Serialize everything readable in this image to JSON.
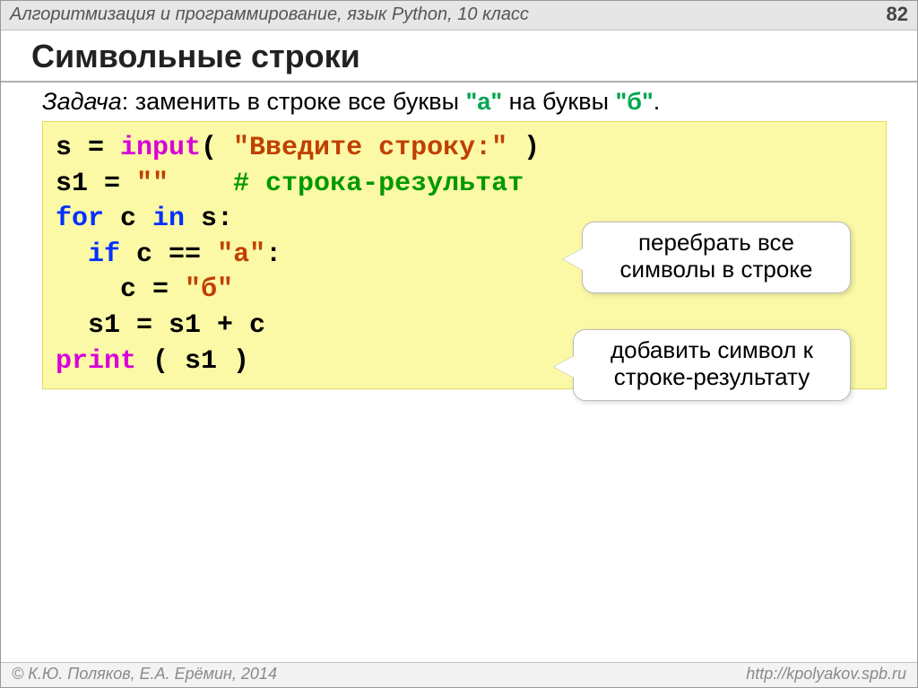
{
  "header": {
    "subject": "Алгоритмизация и программирование, язык Python, 10 класс",
    "page": "82"
  },
  "title": "Символьные строки",
  "task": {
    "label": "Задача",
    "before": ": заменить в строке все буквы ",
    "a": "\"а\"",
    "mid": " на буквы ",
    "b": "\"б\"",
    "end": "."
  },
  "code": {
    "l1_a": "s = ",
    "l1_fn": "input",
    "l1_b": "( ",
    "l1_str": "\"Введите строку:\"",
    "l1_c": " )",
    "l2_a": "s1 = ",
    "l2_str": "\"\"",
    "l2_sp": "    ",
    "l2_cmt": "# строка-результат",
    "l3_for": "for",
    "l3_a": " c ",
    "l3_in": "in",
    "l3_b": " s:",
    "l4_sp": "  ",
    "l4_if": "if",
    "l4_a": " c == ",
    "l4_str": "\"а\"",
    "l4_b": ":",
    "l5_sp": "    c = ",
    "l5_str": "\"б\"",
    "l6": "  s1 = s1 + c",
    "l7_fn": "print",
    "l7_a": " ( s1 )"
  },
  "callouts": {
    "c1": "перебрать все символы в строке",
    "c2": "добавить символ к строке-результату"
  },
  "footer": {
    "left": "© К.Ю. Поляков, Е.А. Ерёмин, 2014",
    "right": "http://kpolyakov.spb.ru"
  }
}
